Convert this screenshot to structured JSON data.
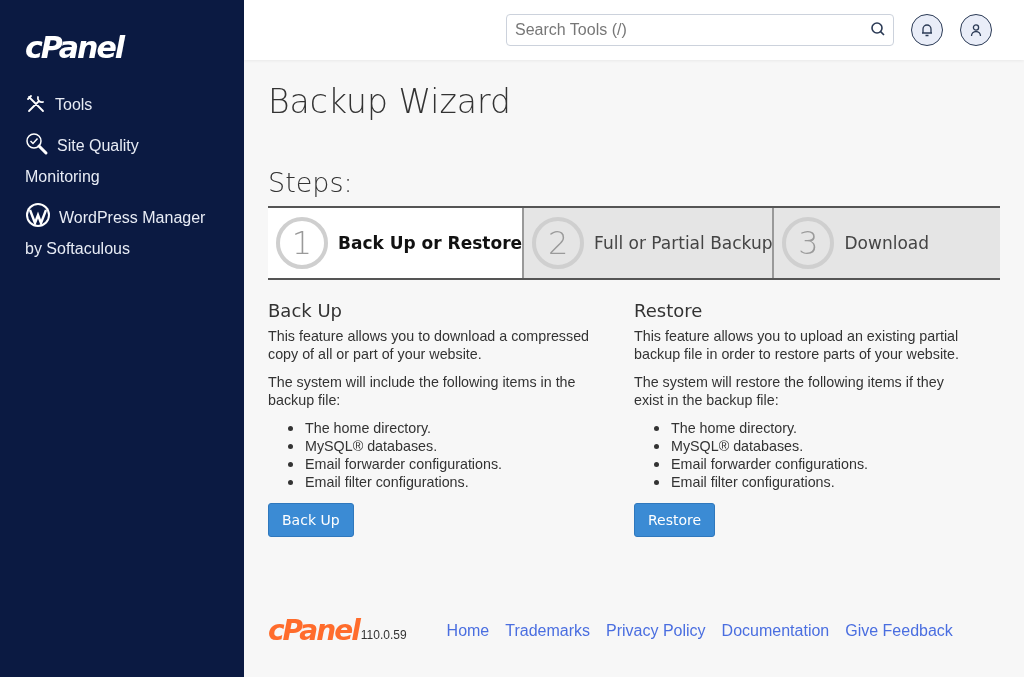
{
  "sidebar": {
    "logo": "cPanel",
    "items": [
      {
        "label": "Tools",
        "selected": false
      },
      {
        "label": "Site Quality Monitoring",
        "selected": false
      },
      {
        "label": "WordPress Manager by Softaculous",
        "selected": false
      }
    ]
  },
  "header": {
    "search": {
      "placeholder": "Search Tools (/)"
    }
  },
  "page_title": "Backup Wizard",
  "steps_heading": "Steps:",
  "steps": [
    {
      "number": "1",
      "label": "Back Up or Restore",
      "selected": true
    },
    {
      "number": "2",
      "label": "Full or Partial Backup",
      "selected": false
    },
    {
      "number": "3",
      "label": "Download",
      "selected": false
    }
  ],
  "sections": [
    {
      "heading": "Back Up",
      "description": "This feature allows you to download a compressed copy of all or part of your website.",
      "intro": "The system will include the following items in the backup file:",
      "items": [
        "The home directory.",
        "MySQL® databases.",
        "Email forwarder configurations.",
        "Email filter configurations."
      ],
      "button": "Back Up"
    },
    {
      "heading": "Restore",
      "description": "This feature allows you to upload an existing partial backup file in order to restore parts of your website.",
      "intro": "The system will restore the following items if they exist in the backup file:",
      "items": [
        "The home directory.",
        "MySQL® databases.",
        "Email forwarder configurations.",
        "Email filter configurations."
      ],
      "button": "Restore"
    }
  ],
  "footer": {
    "logo": "cPanel",
    "version": "110.0.59",
    "links": [
      "Home",
      "Trademarks",
      "Privacy Policy",
      "Documentation",
      "Give Feedback"
    ]
  }
}
